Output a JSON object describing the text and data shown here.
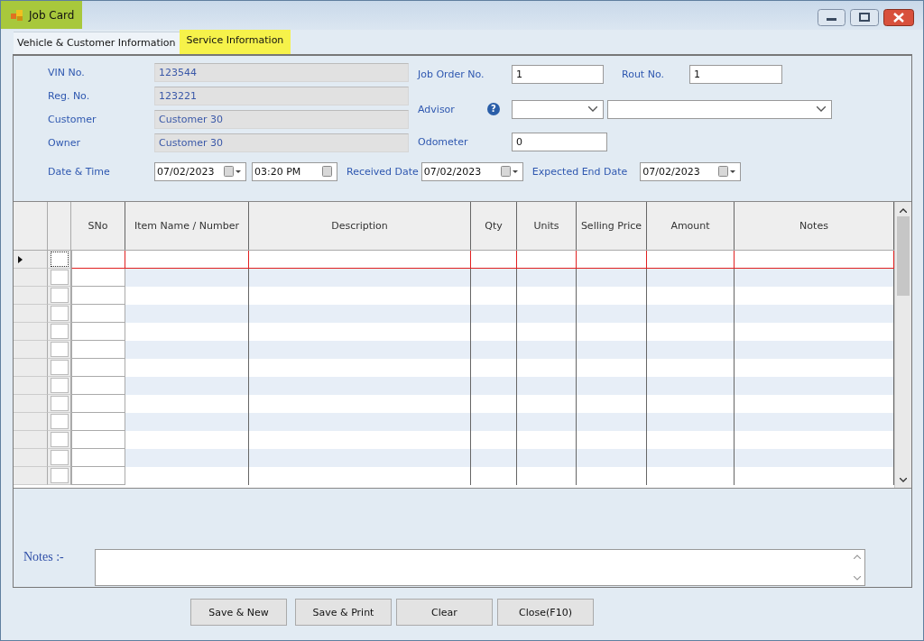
{
  "window": {
    "title": "Job Card",
    "title_highlighted": true
  },
  "tabs": [
    {
      "label": "Vehicle & Customer Information",
      "selected": true,
      "highlighted": false
    },
    {
      "label": "Service Information",
      "selected": false,
      "highlighted": true
    }
  ],
  "vehicle_fields": [
    {
      "label": "VIN No.",
      "value": "123544",
      "disabled": true
    },
    {
      "label": "Reg. No.",
      "value": "123221",
      "disabled": true
    },
    {
      "label": "Customer",
      "value": "Customer 30",
      "disabled": true
    },
    {
      "label": "Owner",
      "value": "Customer 30",
      "disabled": true
    }
  ],
  "job_order": {
    "label": "Job Order No.",
    "value": "1"
  },
  "rout": {
    "label": "Rout No.",
    "value": "1"
  },
  "advisor": {
    "label": "Advisor",
    "help": "?"
  },
  "odometer": {
    "label": "Odometer",
    "value": "0"
  },
  "date_time": {
    "label": "Date & Time",
    "date": "07/02/2023",
    "time": "03:20 PM"
  },
  "received_date": {
    "label": "Received Date",
    "date": "07/02/2023"
  },
  "expected_end_date": {
    "label": "Expected End Date",
    "date": "07/02/2023"
  },
  "grid": {
    "columns": [
      "SNo",
      "Item Name / Number",
      "Description",
      "Qty",
      "Units",
      "Selling Price",
      "Amount",
      "Notes"
    ],
    "rows": [
      {
        "current": true,
        "checked": false
      },
      {
        "current": false,
        "checked": false
      },
      {
        "current": false,
        "checked": false
      },
      {
        "current": false,
        "checked": false
      },
      {
        "current": false,
        "checked": false
      },
      {
        "current": false,
        "checked": false
      },
      {
        "current": false,
        "checked": false
      },
      {
        "current": false,
        "checked": false
      },
      {
        "current": false,
        "checked": false
      },
      {
        "current": false,
        "checked": false
      },
      {
        "current": false,
        "checked": false
      },
      {
        "current": false,
        "checked": false
      },
      {
        "current": false,
        "checked": false
      }
    ]
  },
  "notes": {
    "label": "Notes :-"
  },
  "buttons": [
    "Save & New",
    "Save & Print",
    "Clear",
    "Close(F10)"
  ]
}
